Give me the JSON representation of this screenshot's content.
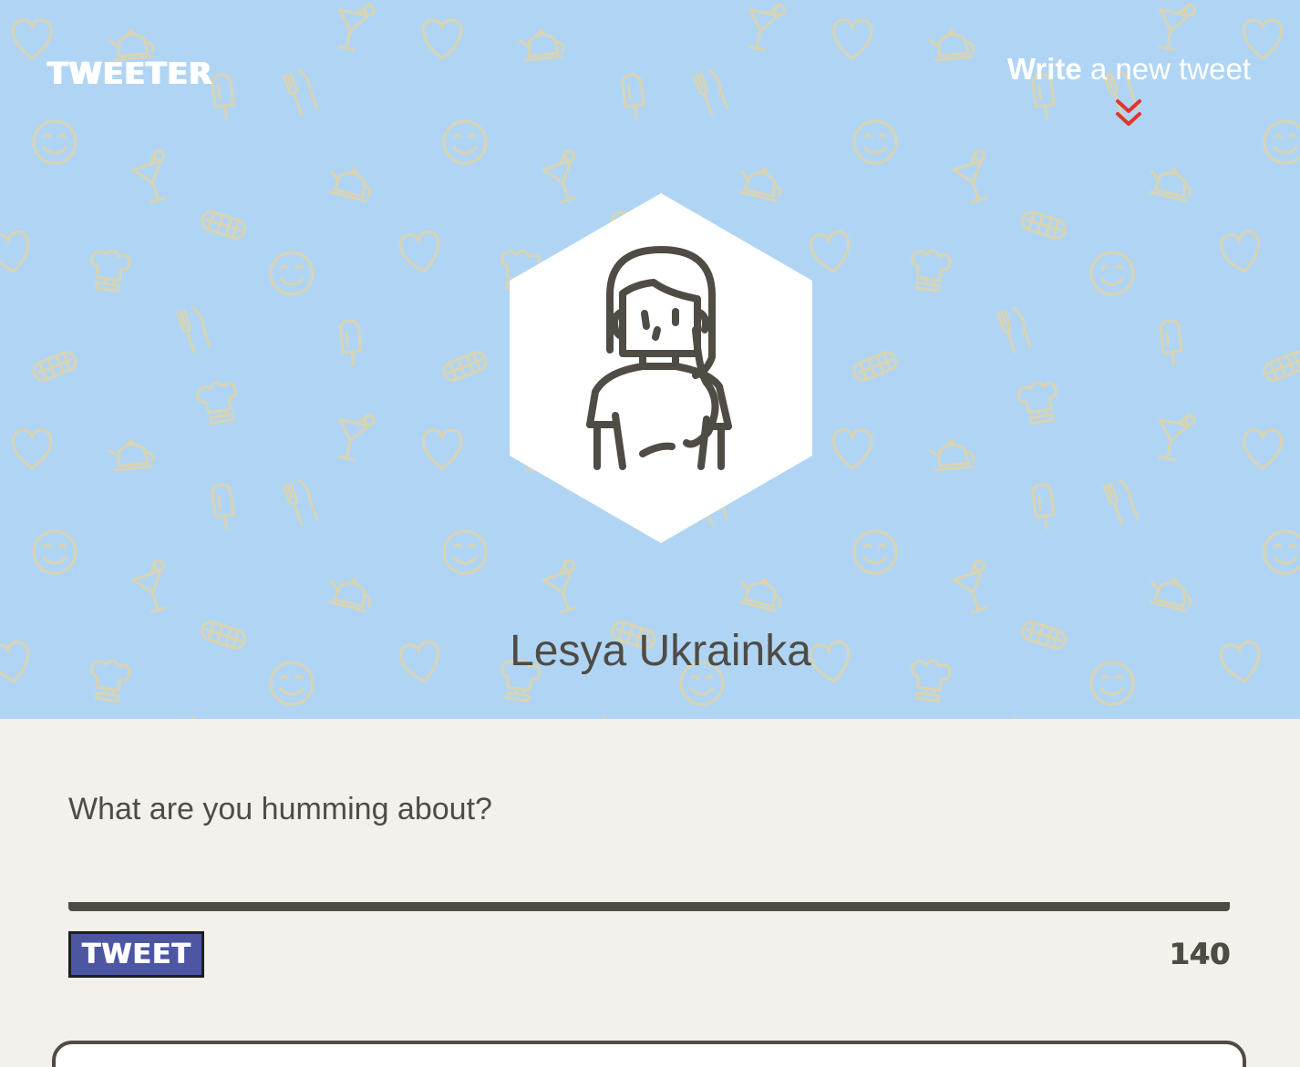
{
  "app": {
    "name": "TWEETER"
  },
  "nav": {
    "compose_strong": "Write",
    "compose_rest": " a new tweet",
    "compose_icon": "double-chevron-down-icon"
  },
  "profile": {
    "name": "Lesya Ukrainka",
    "avatar_icon": "woman-avatar-icon"
  },
  "composer": {
    "prompt": "What are you humming about?",
    "value": "",
    "button_label": "TWEET",
    "char_count": "140"
  },
  "colors": {
    "header_bg": "#b0d5f4",
    "pattern": "#d8d4b4",
    "page_bg": "#f4f1ec",
    "text": "#4f4b45",
    "accent_chevron": "#e2352b",
    "button_bg": "#4c56a3"
  },
  "background_pattern_icons": [
    "heart-icon",
    "teapot-icon",
    "cocktail-icon",
    "fork-knife-icon",
    "popsicle-icon",
    "smiley-icon",
    "hotdog-icon",
    "chef-hat-icon"
  ]
}
